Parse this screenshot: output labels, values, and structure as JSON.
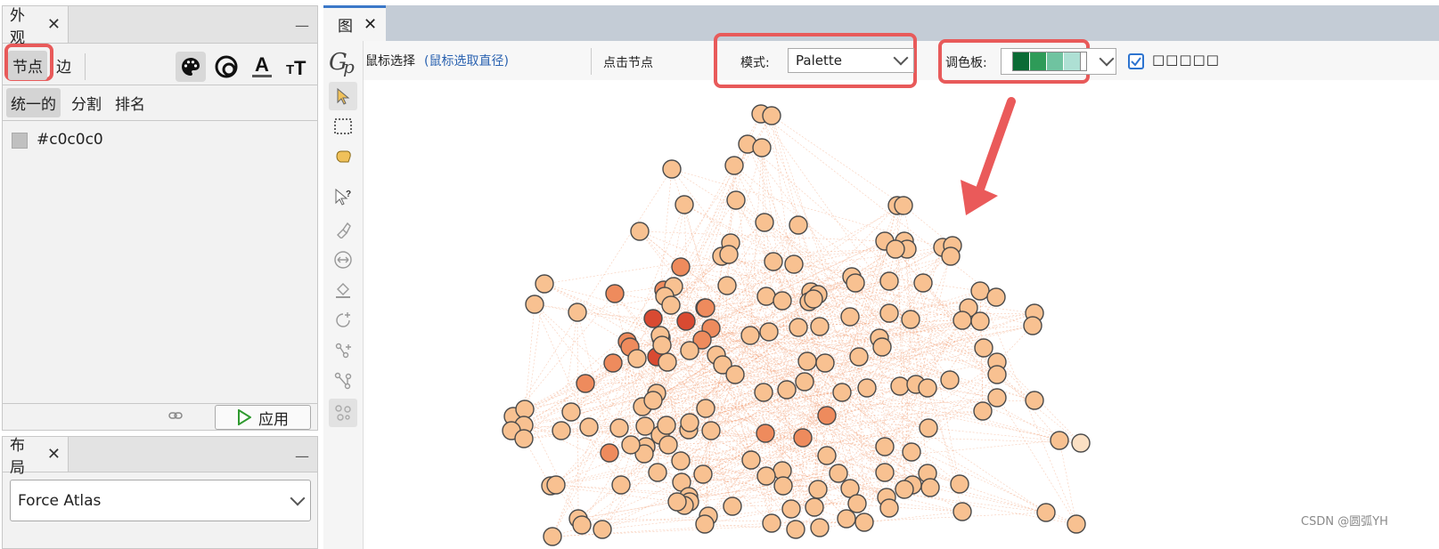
{
  "appearance_panel": {
    "tab_title": "外观",
    "close": "✕",
    "minimize": "—",
    "subtabs": [
      "节点",
      "边"
    ],
    "mode_tabs": [
      "统一的",
      "分割",
      "排名"
    ],
    "color_value": "#c0c0c0",
    "apply_label": "应用"
  },
  "layout_panel": {
    "tab_title": "布局",
    "close": "✕",
    "minimize": "—",
    "algorithm": "Force Atlas"
  },
  "graph_panel": {
    "tab_title": "图",
    "close": "✕",
    "mouse_select": "鼠标选择",
    "mouse_select_hint": "(鼠标选取直径)",
    "click_node": "点击节点",
    "mode_label": "模式:",
    "mode_value": "Palette",
    "palette_label": "调色板:",
    "palette_colors": [
      "#0b6b35",
      "#2e9b58",
      "#6fc3a0",
      "#aee0d4"
    ],
    "checkbox_text": "□□□□□"
  },
  "watermark": "CSDN @圆弧YH",
  "colors": {
    "node_light": "#f8c191",
    "node_mid": "#ee8b5d",
    "node_dark": "#d94a32",
    "edge": "#f3a27a",
    "highlight": "#e85a5a"
  }
}
